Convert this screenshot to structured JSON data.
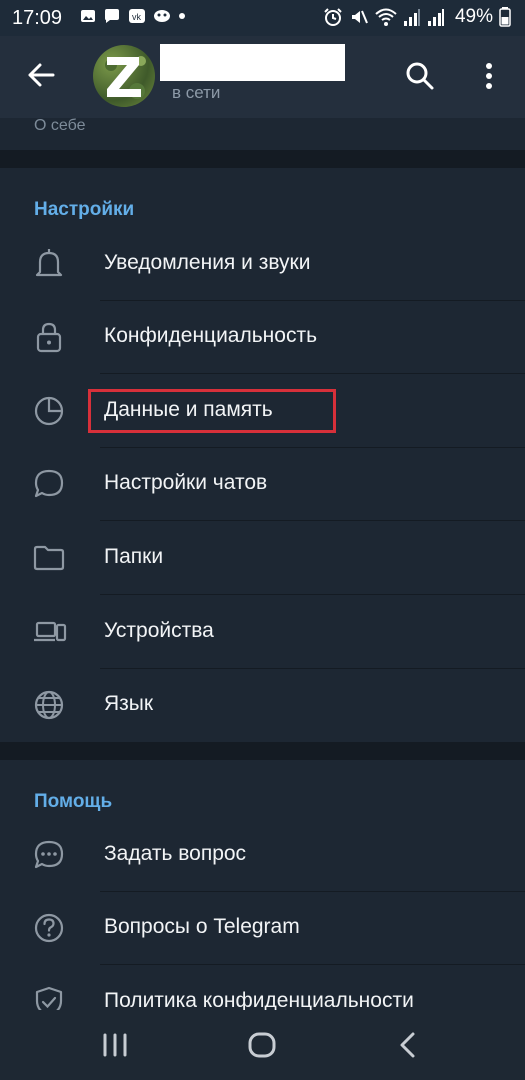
{
  "status_bar": {
    "time": "17:09",
    "battery": "49%"
  },
  "header": {
    "status": "в сети"
  },
  "profile": {
    "about_label": "О себе"
  },
  "settings": {
    "title": "Настройки",
    "items": [
      {
        "label": "Уведомления и звуки",
        "icon": "bell-icon"
      },
      {
        "label": "Конфиденциальность",
        "icon": "lock-icon"
      },
      {
        "label": "Данные и память",
        "icon": "pie-chart-icon"
      },
      {
        "label": "Настройки чатов",
        "icon": "chat-bubble-icon"
      },
      {
        "label": "Папки",
        "icon": "folder-icon"
      },
      {
        "label": "Устройства",
        "icon": "devices-icon"
      },
      {
        "label": "Язык",
        "icon": "globe-icon"
      }
    ]
  },
  "help": {
    "title": "Помощь",
    "items": [
      {
        "label": "Задать вопрос",
        "icon": "chat-dots-icon"
      },
      {
        "label": "Вопросы о Telegram",
        "icon": "question-icon"
      },
      {
        "label": "Политика конфиденциальности",
        "icon": "shield-check-icon"
      }
    ]
  },
  "colors": {
    "background": "#1d2733",
    "header": "#242f3d",
    "accent": "#63aee8",
    "highlight": "#d7303a"
  }
}
